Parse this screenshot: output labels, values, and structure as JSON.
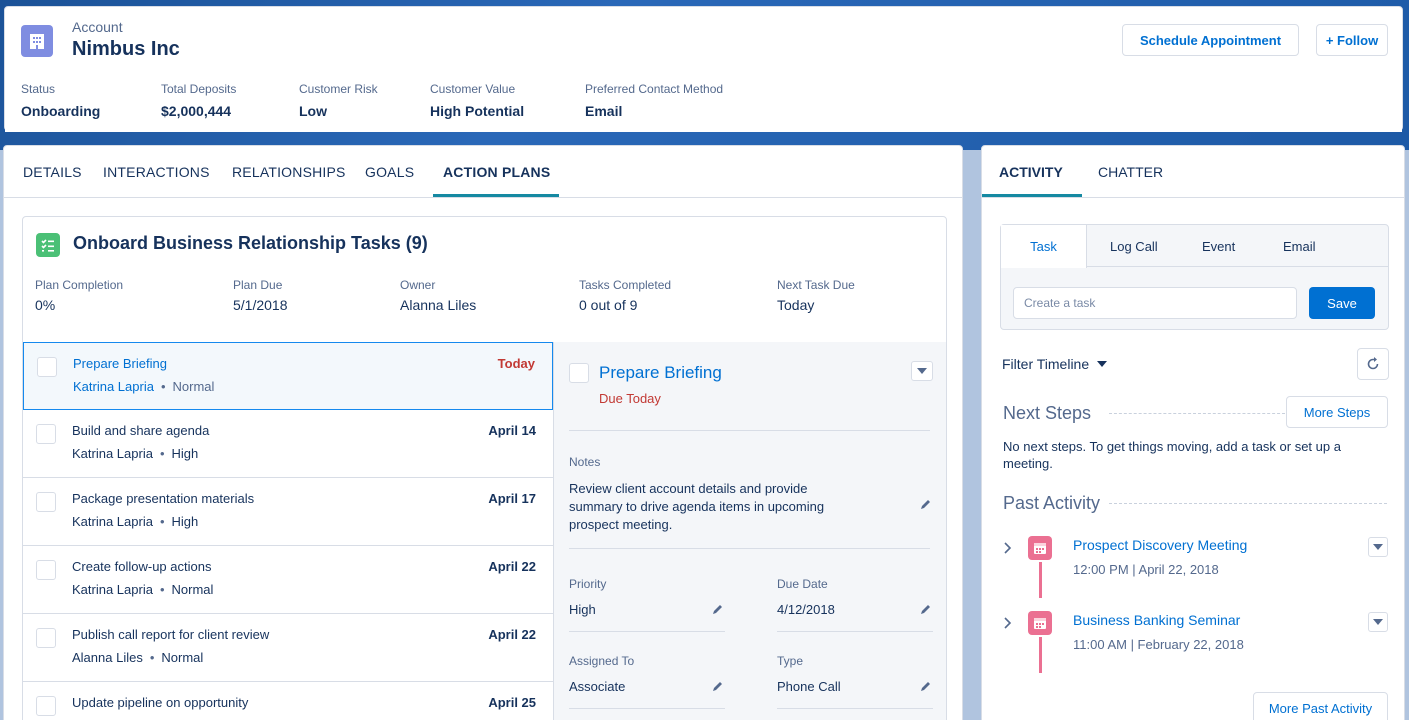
{
  "colors": {
    "brand_blue": "#0070d2",
    "text_dark": "#16325c",
    "text_muted": "#54698d",
    "danger": "#c23934",
    "account_icon": "#7f8de1",
    "plan_icon": "#4bc076",
    "event_icon": "#eb7092",
    "tab_underline": "#1589a2"
  },
  "header": {
    "object_type": "Account",
    "title": "Nimbus Inc",
    "icon": "building-icon",
    "schedule_label": "Schedule Appointment",
    "follow_label": "+ Follow",
    "fields": [
      {
        "label": "Status",
        "value": "Onboarding"
      },
      {
        "label": "Total Deposits",
        "value": "$2,000,444"
      },
      {
        "label": "Customer Risk",
        "value": "Low"
      },
      {
        "label": "Customer Value",
        "value": "High Potential"
      },
      {
        "label": "Preferred Contact Method",
        "value": "Email"
      }
    ]
  },
  "main_tabs": [
    "DETAILS",
    "INTERACTIONS",
    "RELATIONSHIPS",
    "GOALS",
    "ACTION PLANS"
  ],
  "active_main_tab": "ACTION PLANS",
  "plan": {
    "icon": "checklist-icon",
    "title": "Onboard Business Relationship Tasks (9)",
    "fields": [
      {
        "label": "Plan Completion",
        "value": "0%"
      },
      {
        "label": "Plan Due",
        "value": "5/1/2018"
      },
      {
        "label": "Owner",
        "value": "Alanna Liles"
      },
      {
        "label": "Tasks Completed",
        "value": "0 out of 9"
      },
      {
        "label": "Next Task Due",
        "value": "Today"
      }
    ],
    "tasks": [
      {
        "title": "Prepare Briefing",
        "assignee": "Katrina Lapria",
        "priority": "Normal",
        "due": "Today",
        "selected": true
      },
      {
        "title": "Build and share agenda",
        "assignee": "Katrina Lapria",
        "priority": "High",
        "due": "April 14"
      },
      {
        "title": "Package presentation materials",
        "assignee": "Katrina Lapria",
        "priority": "High",
        "due": "April 17"
      },
      {
        "title": "Create follow-up actions",
        "assignee": "Katrina Lapria",
        "priority": "Normal",
        "due": "April 22"
      },
      {
        "title": "Publish call report for client review",
        "assignee": "Alanna Liles",
        "priority": "Normal",
        "due": "April 22"
      },
      {
        "title": "Update pipeline on opportunity",
        "assignee": "",
        "priority": "",
        "due": "April 25"
      }
    ],
    "detail": {
      "title": "Prepare Briefing",
      "due": "Due Today",
      "notes_label": "Notes",
      "notes": "Review client account details and provide summary to drive agenda items in upcoming prospect meeting.",
      "priority_label": "Priority",
      "priority": "High",
      "due_date_label": "Due Date",
      "due_date": "4/12/2018",
      "assigned_label": "Assigned To",
      "assigned": "Associate",
      "type_label": "Type",
      "type": "Phone Call"
    }
  },
  "side": {
    "tabs": [
      "ACTIVITY",
      "CHATTER"
    ],
    "active_tab": "ACTIVITY",
    "composer": {
      "tabs": [
        "Task",
        "Log Call",
        "Event",
        "Email"
      ],
      "active": "Task",
      "placeholder": "Create a task",
      "save_label": "Save"
    },
    "filter_label": "Filter Timeline",
    "next_steps": {
      "title": "Next Steps",
      "button": "More Steps",
      "empty_text": "No next steps. To get things moving, add a task or set up a meeting."
    },
    "past_activity": {
      "title": "Past Activity",
      "items": [
        {
          "title": "Prospect Discovery Meeting",
          "meta": "12:00 PM | April 22, 2018"
        },
        {
          "title": "Business Banking Seminar",
          "meta": "11:00 AM | February 22, 2018"
        }
      ],
      "button": "More Past Activity"
    }
  }
}
